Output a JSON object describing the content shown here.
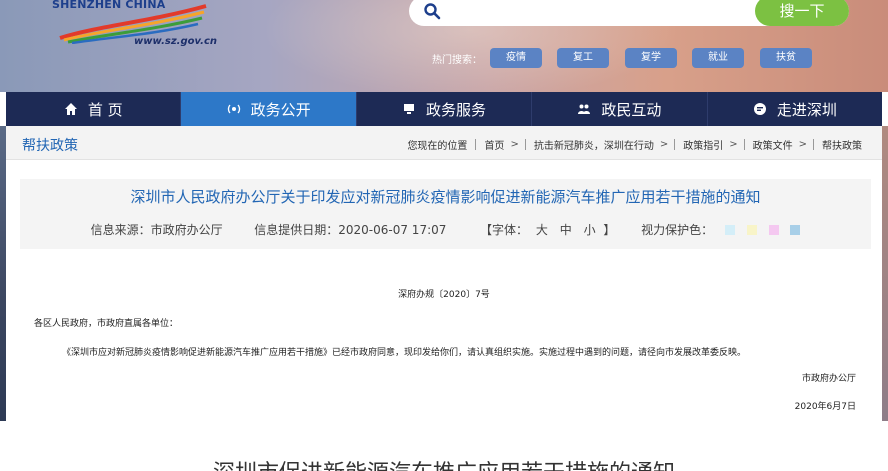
{
  "header": {
    "logo_text": "SHENZHEN  CHINA",
    "logo_url": "www.sz.gov.cn",
    "search": {
      "placeholder": "",
      "button_label": "搜一下"
    },
    "hot_search_label": "热门搜索：",
    "hot_tags": [
      "疫情",
      "复工",
      "复学",
      "就业",
      "扶贫"
    ]
  },
  "nav": {
    "items": [
      {
        "label": "首  页",
        "icon": "home-icon"
      },
      {
        "label": "政务公开",
        "icon": "broadcast-icon",
        "active": true
      },
      {
        "label": "政务服务",
        "icon": "monitor-icon"
      },
      {
        "label": "政民互动",
        "icon": "people-icon"
      },
      {
        "label": "走进深圳",
        "icon": "chat-icon"
      }
    ]
  },
  "breadcrumb": {
    "section_title": "帮扶政策",
    "location_label": "您现在的位置",
    "items": [
      "首页",
      "抗击新冠肺炎，深圳在行动",
      "政策指引",
      "政策文件",
      "帮扶政策"
    ]
  },
  "article": {
    "title": "深圳市人民政府办公厅关于印发应对新冠肺炎疫情影响促进新能源汽车推广应用若干措施的通知",
    "source": "信息来源：市政府办公厅",
    "date": "信息提供日期：2020-06-07 17:07",
    "font_label_open": "【字体：",
    "font_sizes": [
      "大",
      "中",
      "小"
    ],
    "font_label_close": "】",
    "vision_label": "视力保护色：",
    "vision_colors": [
      "#d4eef8",
      "#f8f4c8",
      "#f4c8f0",
      "#a8cfe8"
    ],
    "doc_number": "深府办规〔2020〕7号",
    "recipient": "各区人民政府，市政府直属各单位：",
    "body": "《深圳市应对新冠肺炎疫情影响促进新能源汽车推广应用若干措施》已经市政府同意，现印发给你们，请认真组织实施。实施过程中遇到的问题，请径向市发展改革委反映。",
    "issuer": "市政府办公厅",
    "issue_date": "2020年6月7日"
  },
  "caption": "深圳市促进新能源汽车推广应用若干措施的通知"
}
